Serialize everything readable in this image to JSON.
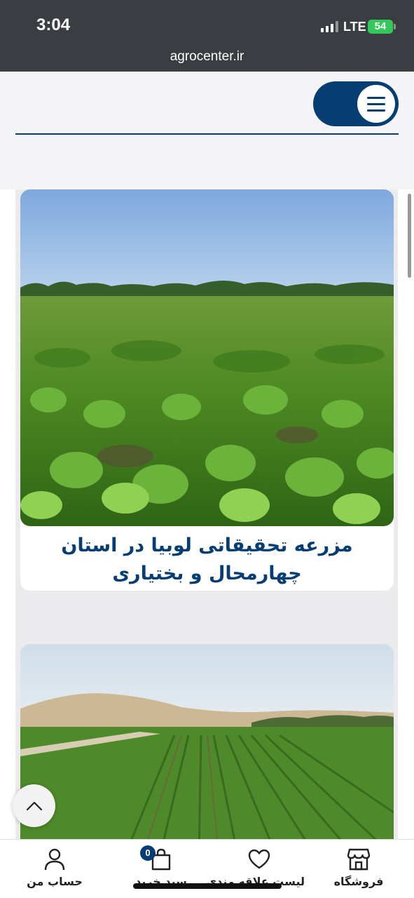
{
  "status_bar": {
    "time": "3:04",
    "network": "LTE",
    "battery": "54"
  },
  "browser": {
    "url": "agrocenter.ir"
  },
  "header": {
    "menu_icon": "hamburger-menu-icon",
    "brand_color": "#063e73"
  },
  "posts": [
    {
      "title": "مزرعه تحقیقاتی لوبیا در استان چهارمحال و بختیاری",
      "image": "bean-field-photo"
    },
    {
      "title": "",
      "image": "field-rows-mountains-photo"
    }
  ],
  "bottom_nav": {
    "items": [
      {
        "label": "فروشگاه",
        "icon": "store-icon"
      },
      {
        "label": "لیست علاقه مندی",
        "icon": "heart-icon"
      },
      {
        "label": "سبد خرید",
        "icon": "shopping-bag-icon"
      },
      {
        "label": "حساب من",
        "icon": "user-icon"
      }
    ],
    "cart_count": "0"
  }
}
